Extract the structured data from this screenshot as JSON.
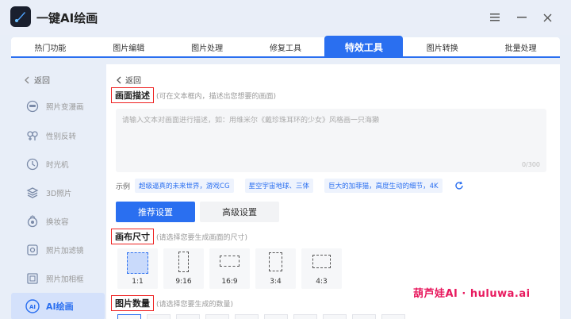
{
  "window": {
    "title": "一键AI绘画",
    "menu_icon": "hamburger-menu-icon",
    "minimize_icon": "minimize-icon",
    "close_icon": "close-icon"
  },
  "tabs": [
    {
      "label": "热门功能",
      "active": false
    },
    {
      "label": "图片编辑",
      "active": false
    },
    {
      "label": "图片处理",
      "active": false
    },
    {
      "label": "修复工具",
      "active": false
    },
    {
      "label": "特效工具",
      "active": true
    },
    {
      "label": "图片转换",
      "active": false
    },
    {
      "label": "批量处理",
      "active": false
    }
  ],
  "sidebar": {
    "back_label": "返回",
    "items": [
      {
        "label": "照片变漫画",
        "icon": "cartoon-face-icon",
        "active": false
      },
      {
        "label": "性别反转",
        "icon": "gender-icon",
        "active": false
      },
      {
        "label": "时光机",
        "icon": "clock-icon",
        "active": false
      },
      {
        "label": "3D照片",
        "icon": "layers-icon",
        "active": false
      },
      {
        "label": "换妆容",
        "icon": "makeup-icon",
        "active": false
      },
      {
        "label": "照片加滤镜",
        "icon": "filter-icon",
        "active": false
      },
      {
        "label": "照片加相框",
        "icon": "frame-icon",
        "active": false
      },
      {
        "label": "AI绘画",
        "icon": "ai-icon",
        "active": true
      }
    ]
  },
  "main": {
    "back_label": "返回",
    "description": {
      "title": "画面描述",
      "hint": "(可在文本框内，描述出您想要的画面)",
      "placeholder": "请输入文本对画面进行描述，如：用维米尔《戴珍珠耳环的少女》风格画一只海獭",
      "counter": "0/300"
    },
    "examples": {
      "label": "示例",
      "chips": [
        "超级逼真的未来世界，游戏CG",
        "星空宇宙地球、三体",
        "巨大的加菲猫，高度生动的细节，4K"
      ]
    },
    "settings": {
      "recommended": "推荐设置",
      "advanced": "高级设置"
    },
    "canvas": {
      "title": "画布尺寸",
      "hint": "(请选择您要生成画面的尺寸)",
      "ratios": [
        {
          "label": "1:1",
          "active": true
        },
        {
          "label": "9:16",
          "active": false
        },
        {
          "label": "16:9",
          "active": false
        },
        {
          "label": "3:4",
          "active": false
        },
        {
          "label": "4:3",
          "active": false
        }
      ]
    },
    "quantity": {
      "title": "图片数量",
      "hint": "(请选择您要生成的数量)"
    }
  },
  "watermark": "葫芦娃AI · huluwa.ai",
  "colors": {
    "accent": "#2a6ff0",
    "highlight_border": "#ee2222",
    "watermark": "#e8195e"
  }
}
